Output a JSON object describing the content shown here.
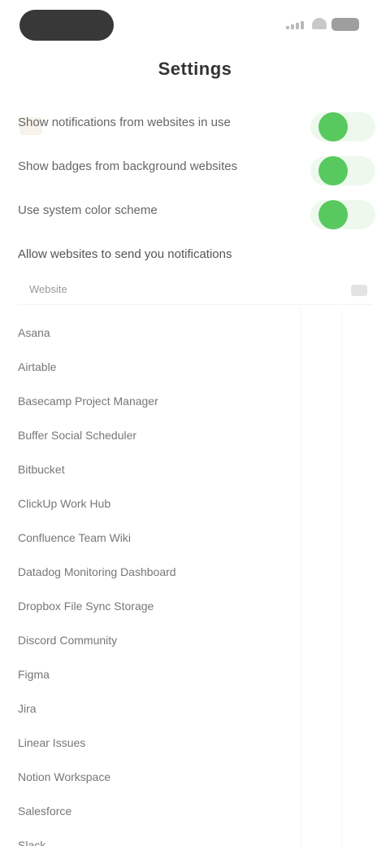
{
  "status_bar": {
    "time": "",
    "icons": [
      "signal-icon",
      "wifi-icon",
      "battery-icon"
    ]
  },
  "nav": {
    "title": "Settings",
    "back_icon": "back-icon"
  },
  "toggles": [
    {
      "label": "Show notifications from websites in use",
      "on": true
    },
    {
      "label": "Show badges from background websites",
      "on": true
    },
    {
      "label": "Use system color scheme",
      "on": true
    }
  ],
  "section": {
    "title": "Allow websites to send you notifications"
  },
  "table": {
    "header": "Website",
    "sort_icon": "sort-icon"
  },
  "sites": [
    "Asana",
    "Airtable",
    "Basecamp Project Manager",
    "Buffer Social Scheduler",
    "Bitbucket",
    "ClickUp Work Hub",
    "Confluence Team Wiki",
    "Datadog Monitoring Dashboard",
    "Dropbox File Sync Storage",
    "Discord Community",
    "Figma",
    "Jira",
    "Linear Issues",
    "Notion Workspace",
    "Salesforce",
    "Slack"
  ],
  "colors": {
    "toggle_on": "#58c95f",
    "toggle_track": "#eef9ee",
    "status_pill": "#222222",
    "title_text": "#333333"
  }
}
